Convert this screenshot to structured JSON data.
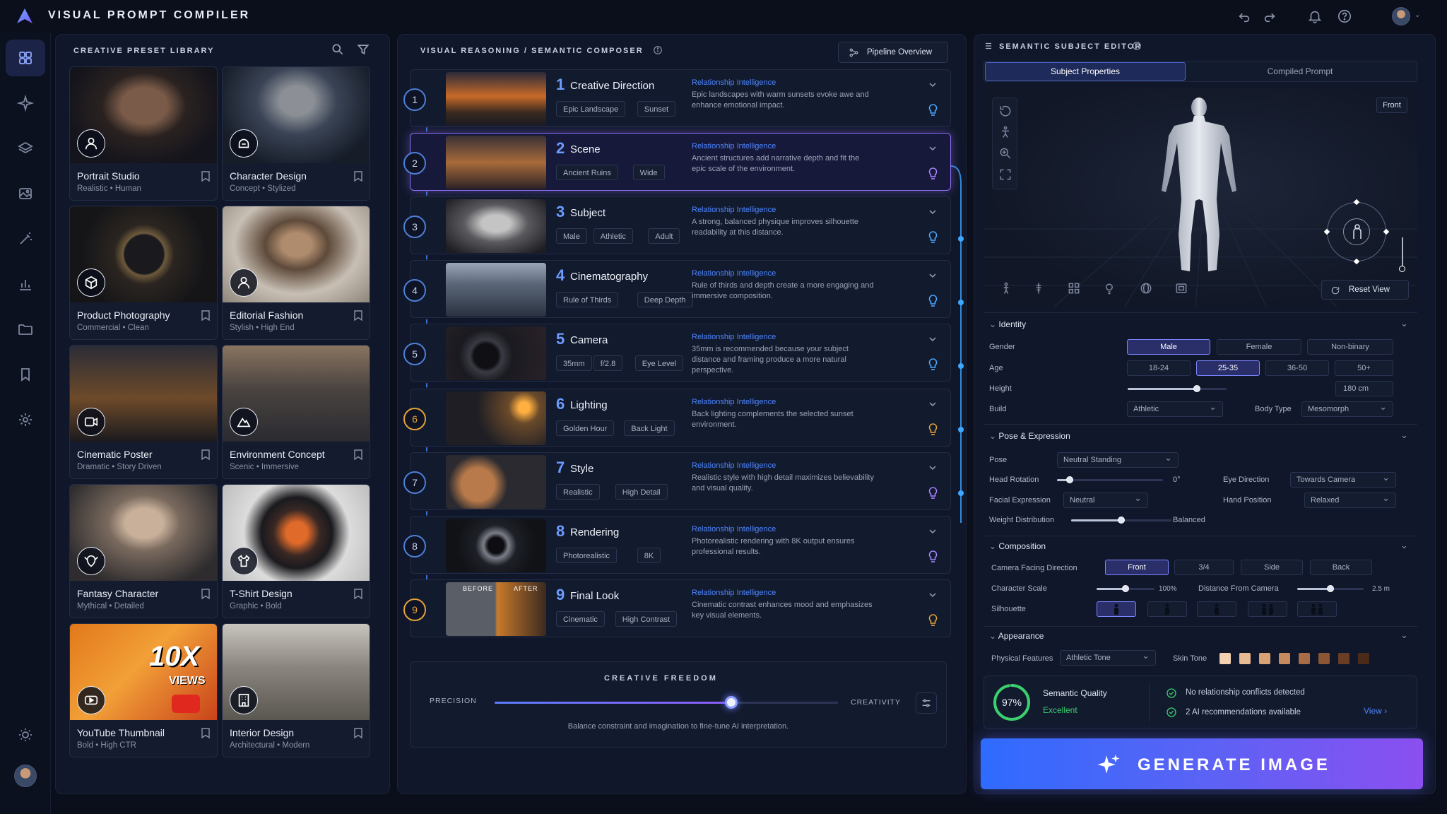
{
  "app": {
    "title": "VISUAL PROMPT COMPILER"
  },
  "library": {
    "title": "CREATIVE PRESET LIBRARY",
    "presets": [
      {
        "name": "Portrait Studio",
        "sub": "Realistic • Human",
        "icon": "user-icon"
      },
      {
        "name": "Character Design",
        "sub": "Concept • Stylized",
        "icon": "helmet-icon"
      },
      {
        "name": "Product Photography",
        "sub": "Commercial • Clean",
        "icon": "cube-icon"
      },
      {
        "name": "Editorial Fashion",
        "sub": "Stylish • High End",
        "icon": "user-icon"
      },
      {
        "name": "Cinematic Poster",
        "sub": "Dramatic • Story Driven",
        "icon": "video-icon"
      },
      {
        "name": "Environment Concept",
        "sub": "Scenic • Immersive",
        "icon": "mountain-icon"
      },
      {
        "name": "Fantasy Character",
        "sub": "Mythical • Detailed",
        "icon": "elf-icon"
      },
      {
        "name": "T-Shirt Design",
        "sub": "Graphic • Bold",
        "icon": "shirt-icon"
      },
      {
        "name": "YouTube Thumbnail",
        "sub": "Bold • High CTR",
        "icon": "play-icon"
      },
      {
        "name": "Interior Design",
        "sub": "Architectural • Modern",
        "icon": "building-icon"
      }
    ],
    "thumb_text": {
      "big": "10X",
      "small": "VIEWS"
    }
  },
  "composer": {
    "title": "VISUAL REASONING / SEMANTIC COMPOSER",
    "pipeline_button": "Pipeline Overview",
    "ri_label": "Relationship Intelligence",
    "steps": [
      {
        "num": "1",
        "name": "Creative Direction",
        "tags": [
          "Epic Landscape",
          "Sunset"
        ],
        "desc": "Epic landscapes with warm sunsets evoke awe and enhance emotional impact."
      },
      {
        "num": "2",
        "name": "Scene",
        "tags": [
          "Ancient Ruins",
          "Wide"
        ],
        "desc": "Ancient structures add narrative depth and fit the epic scale of the environment."
      },
      {
        "num": "3",
        "name": "Subject",
        "tags": [
          "Male",
          "Athletic",
          "Adult"
        ],
        "desc": "A strong, balanced physique improves silhouette readability at this distance."
      },
      {
        "num": "4",
        "name": "Cinematography",
        "tags": [
          "Rule of Thirds",
          "Deep Depth"
        ],
        "desc": "Rule of thirds and depth create a more engaging and immersive composition."
      },
      {
        "num": "5",
        "name": "Camera",
        "tags": [
          "35mm",
          "f/2.8",
          "Eye Level"
        ],
        "desc": "35mm is recommended because your subject distance and framing produce a more natural perspective."
      },
      {
        "num": "6",
        "name": "Lighting",
        "tags": [
          "Golden Hour",
          "Back Light"
        ],
        "desc": "Back lighting complements the selected sunset environment."
      },
      {
        "num": "7",
        "name": "Style",
        "tags": [
          "Realistic",
          "High Detail"
        ],
        "desc": "Realistic style with high detail maximizes believability and visual quality."
      },
      {
        "num": "8",
        "name": "Rendering",
        "tags": [
          "Photorealistic",
          "8K"
        ],
        "desc": "Photorealistic rendering with 8K output ensures professional results."
      },
      {
        "num": "9",
        "name": "Final Look",
        "tags": [
          "Cinematic",
          "High Contrast"
        ],
        "desc": "Cinematic contrast enhances mood and emphasizes key visual elements."
      }
    ],
    "before_label": "BEFORE",
    "after_label": "AFTER",
    "freedom": {
      "title": "CREATIVE FREEDOM",
      "left": "PRECISION",
      "right": "CREATIVITY",
      "value": 0.69,
      "hint": "Balance constraint and imagination to fine-tune AI interpretation."
    }
  },
  "editor": {
    "title": "SEMANTIC SUBJECT EDITOR",
    "tabs": [
      "Subject Properties",
      "Compiled Prompt"
    ],
    "view_label": "Front",
    "reset_view": "Reset View",
    "identity": {
      "header": "Identity",
      "gender_label": "Gender",
      "genders": [
        "Male",
        "Female",
        "Non-binary"
      ],
      "age_label": "Age",
      "ages": [
        "18-24",
        "25-35",
        "36-50",
        "50+"
      ],
      "height_label": "Height",
      "height_value": "180 cm",
      "height_fraction": 0.7,
      "build_label": "Build",
      "build_value": "Athletic",
      "bodytype_label": "Body Type",
      "bodytype_value": "Mesomorph"
    },
    "pose": {
      "header": "Pose & Expression",
      "pose_label": "Pose",
      "pose_value": "Neutral Standing",
      "head_label": "Head Rotation",
      "head_value": "0°",
      "head_fraction": 0.12,
      "eye_label": "Eye Direction",
      "eye_value": "Towards Camera",
      "face_label": "Facial Expression",
      "face_value": "Neutral",
      "hand_label": "Hand Position",
      "hand_value": "Relaxed",
      "weight_label": "Weight Distribution",
      "weight_value": "Balanced",
      "weight_fraction": 0.5
    },
    "composition": {
      "header": "Composition",
      "facing_label": "Camera Facing Direction",
      "facings": [
        "Front",
        "3/4",
        "Side",
        "Back"
      ],
      "scale_label": "Character Scale",
      "scale_value": "100%",
      "scale_fraction": 0.5,
      "distance_label": "Distance From Camera",
      "distance_value": "2.5 m",
      "distance_fraction": 0.5,
      "silhouette_label": "Silhouette"
    },
    "appearance": {
      "header": "Appearance",
      "features_label": "Physical Features",
      "features_value": "Athletic Tone",
      "skin_label": "Skin Tone",
      "skin_tones": [
        "#f3d1b0",
        "#e8bb92",
        "#d8a274",
        "#c58a5e",
        "#a86d45",
        "#8a5634",
        "#6a3e24",
        "#4a2a18"
      ]
    },
    "quality": {
      "percent": "97%",
      "value": 0.97,
      "label": "Semantic Quality",
      "rating": "Excellent",
      "check1": "No relationship conflicts detected",
      "check2": "2 AI recommendations available",
      "view_link": "View ›"
    },
    "generate": "GENERATE IMAGE"
  },
  "colors": {
    "accent": "#5b7cff",
    "purple": "#8b5cf6",
    "green": "#3ccf6e",
    "orange": "#e4a23a",
    "blue": "#4d86ff"
  }
}
